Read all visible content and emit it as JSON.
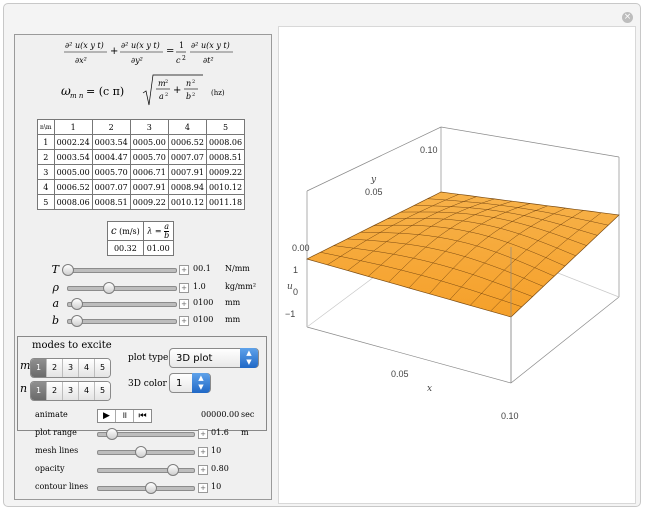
{
  "equations": {
    "wave_u": "u(x y t)",
    "c2": "c",
    "omega_lhs": "ω",
    "omega_sub": "m n",
    "omega_eq": "= (c π)",
    "m": "m",
    "n": "n",
    "a": "a",
    "b": "b",
    "hz": "(hz)"
  },
  "omega_table": {
    "corner": "n\\m",
    "cols": [
      "1",
      "2",
      "3",
      "4",
      "5"
    ],
    "rows": [
      {
        "n": "1",
        "vals": [
          "0002.24",
          "0003.54",
          "0005.00",
          "0006.52",
          "0008.06"
        ]
      },
      {
        "n": "2",
        "vals": [
          "0003.54",
          "0004.47",
          "0005.70",
          "0007.07",
          "0008.51"
        ]
      },
      {
        "n": "3",
        "vals": [
          "0005.00",
          "0005.70",
          "0006.71",
          "0007.91",
          "0009.22"
        ]
      },
      {
        "n": "4",
        "vals": [
          "0006.52",
          "0007.07",
          "0007.91",
          "0008.94",
          "0010.12"
        ]
      },
      {
        "n": "5",
        "vals": [
          "0008.06",
          "0008.51",
          "0009.22",
          "0010.12",
          "0011.18"
        ]
      }
    ]
  },
  "c_lambda": {
    "c_head": "c",
    "c_unit": "(m/s)",
    "lambda_head": "λ =",
    "lambda_num": "a",
    "lambda_den": "b",
    "c_value": "00.32",
    "lambda_value": "01.00"
  },
  "params": [
    {
      "label": "T",
      "value": "00.1",
      "unit": "N/mm",
      "frac": 0.0
    },
    {
      "label": "ρ",
      "value": "1.0",
      "unit": "kg/mm²",
      "frac": 0.38
    },
    {
      "label": "a",
      "value": "0100",
      "unit": "mm",
      "frac": 0.08
    },
    {
      "label": "b",
      "value": "0100",
      "unit": "mm",
      "frac": 0.08
    }
  ],
  "modes": {
    "title": "modes to excite",
    "m_label": "m",
    "n_label": "n",
    "options": [
      "1",
      "2",
      "3",
      "4",
      "5"
    ],
    "m_selected": "1",
    "n_selected": "1",
    "plot_type_label": "plot type",
    "plot_type_value": "3D plot",
    "color_label": "3D color",
    "color_value": "1"
  },
  "lower": {
    "animate_label": "animate",
    "play": "▶",
    "pause": "॥",
    "reset": "⏮",
    "time_value": "00000.00",
    "time_unit": "sec",
    "sliders": [
      {
        "label": "plot range",
        "value": "01.6",
        "unit": "m",
        "frac": 0.15
      },
      {
        "label": "mesh lines",
        "value": "10",
        "unit": "",
        "frac": 0.45
      },
      {
        "label": "opacity",
        "value": "0.80",
        "unit": "",
        "frac": 0.78
      },
      {
        "label": "contour lines",
        "value": "10",
        "unit": "",
        "frac": 0.55
      }
    ]
  },
  "plot": {
    "y_ticks": [
      "0.10",
      "0.05",
      "0.00"
    ],
    "u_ticks": [
      "1",
      "0",
      "−1"
    ],
    "x_ticks": [
      "0.05",
      "0.10"
    ],
    "y_label": "y",
    "u_label": "u",
    "x_label": "x",
    "surface_color": "#f5a02a"
  }
}
